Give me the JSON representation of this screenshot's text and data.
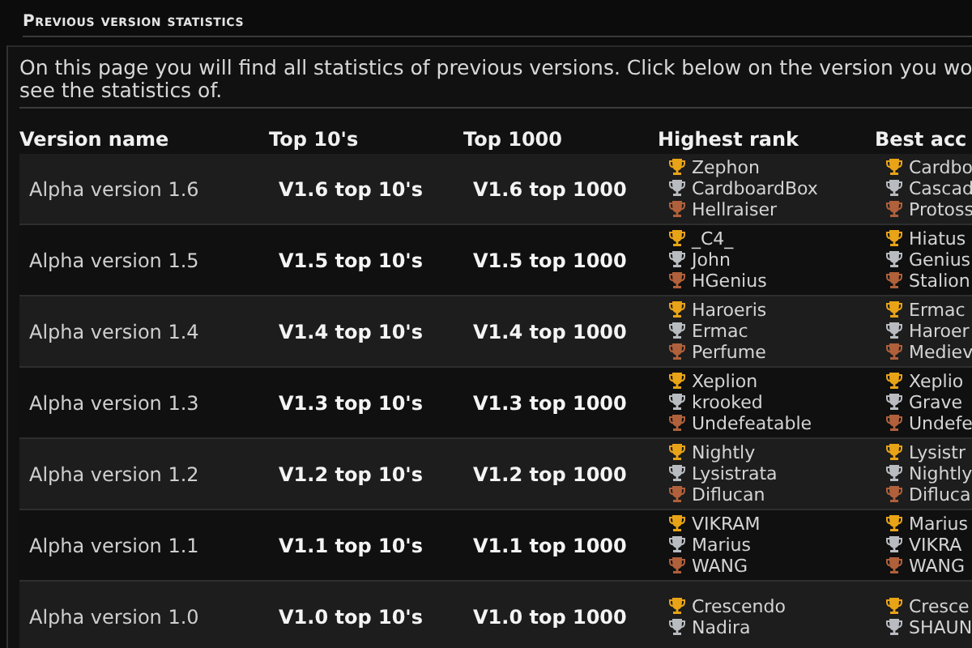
{
  "section": {
    "title": "Previous version statistics",
    "intro_lines": [
      "On this page you will find all statistics of previous versions. Click below on the version you wo",
      "see the statistics of."
    ]
  },
  "table": {
    "columns": [
      "Version name",
      "Top 10's",
      "Top 1000",
      "Highest rank",
      "Best acc"
    ],
    "rows": [
      {
        "version": "Alpha version 1.6",
        "top10": "V1.6 top 10's",
        "top1000": "V1.6 top 1000",
        "highest": [
          {
            "name": "Zephon",
            "kind": "gold"
          },
          {
            "name": "CardboardBox",
            "kind": "silver"
          },
          {
            "name": "Hellraiser",
            "kind": "bronze"
          }
        ],
        "best": [
          {
            "name": "Cardbo",
            "kind": "gold"
          },
          {
            "name": "Cascad",
            "kind": "silver"
          },
          {
            "name": "Protoss",
            "kind": "bronze"
          }
        ]
      },
      {
        "version": "Alpha version 1.5",
        "top10": "V1.5 top 10's",
        "top1000": "V1.5 top 1000",
        "highest": [
          {
            "name": "_C4_",
            "kind": "gold"
          },
          {
            "name": "John",
            "kind": "silver"
          },
          {
            "name": "HGenius",
            "kind": "bronze"
          }
        ],
        "best": [
          {
            "name": "Hiatus",
            "kind": "gold"
          },
          {
            "name": "Genius",
            "kind": "silver"
          },
          {
            "name": "Stalion",
            "kind": "bronze"
          }
        ]
      },
      {
        "version": "Alpha version 1.4",
        "top10": "V1.4 top 10's",
        "top1000": "V1.4 top 1000",
        "highest": [
          {
            "name": "Haroeris",
            "kind": "gold"
          },
          {
            "name": "Ermac",
            "kind": "silver"
          },
          {
            "name": "Perfume",
            "kind": "bronze"
          }
        ],
        "best": [
          {
            "name": "Ermac",
            "kind": "gold"
          },
          {
            "name": "Haroer",
            "kind": "silver"
          },
          {
            "name": "Mediev",
            "kind": "bronze"
          }
        ]
      },
      {
        "version": "Alpha version 1.3",
        "top10": "V1.3 top 10's",
        "top1000": "V1.3 top 1000",
        "highest": [
          {
            "name": "Xeplion",
            "kind": "gold"
          },
          {
            "name": "krooked",
            "kind": "silver"
          },
          {
            "name": "Undefeatable",
            "kind": "bronze"
          }
        ],
        "best": [
          {
            "name": "Xeplio",
            "kind": "gold"
          },
          {
            "name": "Grave",
            "kind": "silver"
          },
          {
            "name": "Undefe",
            "kind": "bronze"
          }
        ]
      },
      {
        "version": "Alpha version 1.2",
        "top10": "V1.2 top 10's",
        "top1000": "V1.2 top 1000",
        "highest": [
          {
            "name": "Nightly",
            "kind": "gold"
          },
          {
            "name": "Lysistrata",
            "kind": "silver"
          },
          {
            "name": "Diflucan",
            "kind": "bronze"
          }
        ],
        "best": [
          {
            "name": "Lysistr",
            "kind": "gold"
          },
          {
            "name": "Nightly",
            "kind": "silver"
          },
          {
            "name": "Difluca",
            "kind": "bronze"
          }
        ]
      },
      {
        "version": "Alpha version 1.1",
        "top10": "V1.1 top 10's",
        "top1000": "V1.1 top 1000",
        "highest": [
          {
            "name": "VIKRAM",
            "kind": "gold"
          },
          {
            "name": "Marius",
            "kind": "silver"
          },
          {
            "name": "WANG",
            "kind": "bronze"
          }
        ],
        "best": [
          {
            "name": "Marius",
            "kind": "gold"
          },
          {
            "name": "VIKRA",
            "kind": "silver"
          },
          {
            "name": "WANG",
            "kind": "bronze"
          }
        ]
      },
      {
        "version": "Alpha version 1.0",
        "top10": "V1.0 top 10's",
        "top1000": "V1.0 top 1000",
        "highest": [
          {
            "name": "Crescendo",
            "kind": "gold"
          },
          {
            "name": "Nadira",
            "kind": "silver"
          }
        ],
        "best": [
          {
            "name": "Cresce",
            "kind": "gold"
          },
          {
            "name": "SHAUN",
            "kind": "silver"
          }
        ]
      }
    ]
  }
}
